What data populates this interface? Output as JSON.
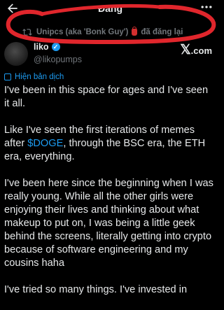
{
  "header": {
    "title": "Đăng",
    "back_icon": "arrow-left-icon",
    "more_icon": "more-icon"
  },
  "repost": {
    "icon": "repost-icon",
    "before": "Unipcs (aka 'Bonk Guy')",
    "after": "đã đăng lại"
  },
  "author": {
    "name": "liko",
    "handle": "@likopumps"
  },
  "brand": {
    "x": "𝕏",
    "suffix": ".com"
  },
  "translate_label": "Hiện bản dịch",
  "tweet": {
    "p1": "I've been in this space for ages and I've seen it all.",
    "p2_before": "Like I've seen the first iterations of memes after ",
    "p2_cashtag": "$DOGE",
    "p2_after": ", through the BSC era, the ETH era, everything.",
    "p3": "I've been here since the beginning when I was really young. While all the other girls were enjoying their lives and thinking about what makeup to put on, I was being a little geek behind the screens, literally getting into crypto because of software engineering and my cousins haha",
    "p4": "I've tried so many things. I've invested in"
  },
  "colors": {
    "background": "#000000",
    "text": "#e7e9ea",
    "muted": "#71767b",
    "link": "#1d9bf0",
    "annotation": "#e0262c"
  }
}
